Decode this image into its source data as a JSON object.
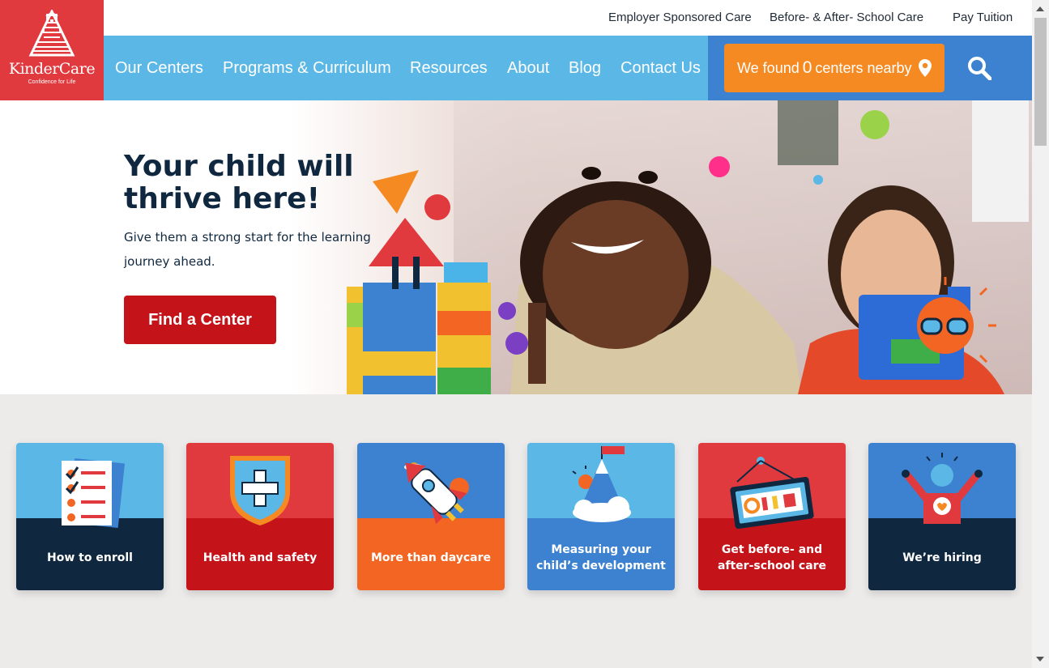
{
  "utility_links": [
    "Employer Sponsored Care",
    "Before- & After- School Care",
    "Pay Tuition"
  ],
  "logo": {
    "word": "KinderCare",
    "tagline": "Confidence for Life"
  },
  "nav": {
    "items": [
      "Our Centers",
      "Programs & Curriculum",
      "Resources",
      "About",
      "Blog",
      "Contact Us"
    ],
    "found": {
      "prefix": "We found",
      "count": "0",
      "suffix": "centers nearby"
    }
  },
  "hero": {
    "title": "Your child will thrive here!",
    "subtitle": "Give them a strong start for the learning journey ahead.",
    "cta": "Find a Center"
  },
  "cards": [
    {
      "label": "How to enroll",
      "icon": "checklist-icon",
      "top_color": "#5bb8e6",
      "bottom_color": "#0f2840"
    },
    {
      "label": "Health and safety",
      "icon": "shield-cross-icon",
      "top_color": "#e0393e",
      "bottom_color": "#c4141a"
    },
    {
      "label": "More than daycare",
      "icon": "rocket-icon",
      "top_color": "#3c82d0",
      "bottom_color": "#f26522"
    },
    {
      "label": "Measuring your child’s development",
      "icon": "mountain-flag-icon",
      "top_color": "#5bb8e6",
      "bottom_color": "#3c82d0"
    },
    {
      "label": "Get before- and after-school care",
      "icon": "open-sign-icon",
      "top_color": "#e0393e",
      "bottom_color": "#c4141a"
    },
    {
      "label": "We’re hiring",
      "icon": "cheering-person-icon",
      "top_color": "#3c82d0",
      "bottom_color": "#0f2840"
    }
  ]
}
